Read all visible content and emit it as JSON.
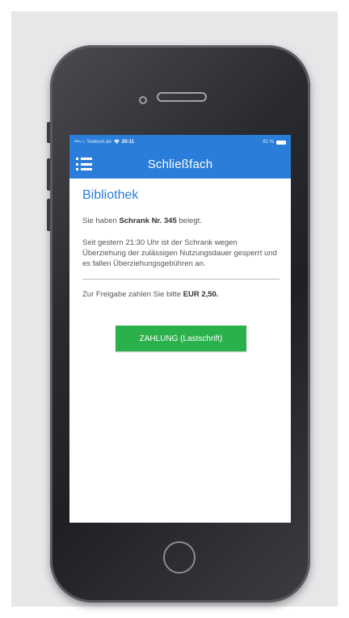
{
  "statusbar": {
    "carrier": "•••○○ Telekom.de",
    "wifi": "wifi-icon",
    "time": "20:11",
    "battery_text": "81 %",
    "battery_icon": "battery-icon"
  },
  "navbar": {
    "title": "Schließfach",
    "menu_icon": "menu-icon"
  },
  "content": {
    "heading": "Bibliothek",
    "intro_prefix": "Sie haben ",
    "locker": "Schrank Nr. 345",
    "intro_suffix": " belegt.",
    "notice": "Seit gestern 21:30 Uhr ist der Schrank wegen Überziehung der zulässigen Nutzungsdauer gesperrt und es fallen Überziehungsgebühren an.",
    "payment_prefix": "Zur Freigabe zahlen Sie bitte ",
    "amount": "EUR 2,50.",
    "pay_button": "ZAHLUNG (Lastschrift)"
  },
  "colors": {
    "primary": "#2a7dd8",
    "button": "#2bb14c"
  }
}
